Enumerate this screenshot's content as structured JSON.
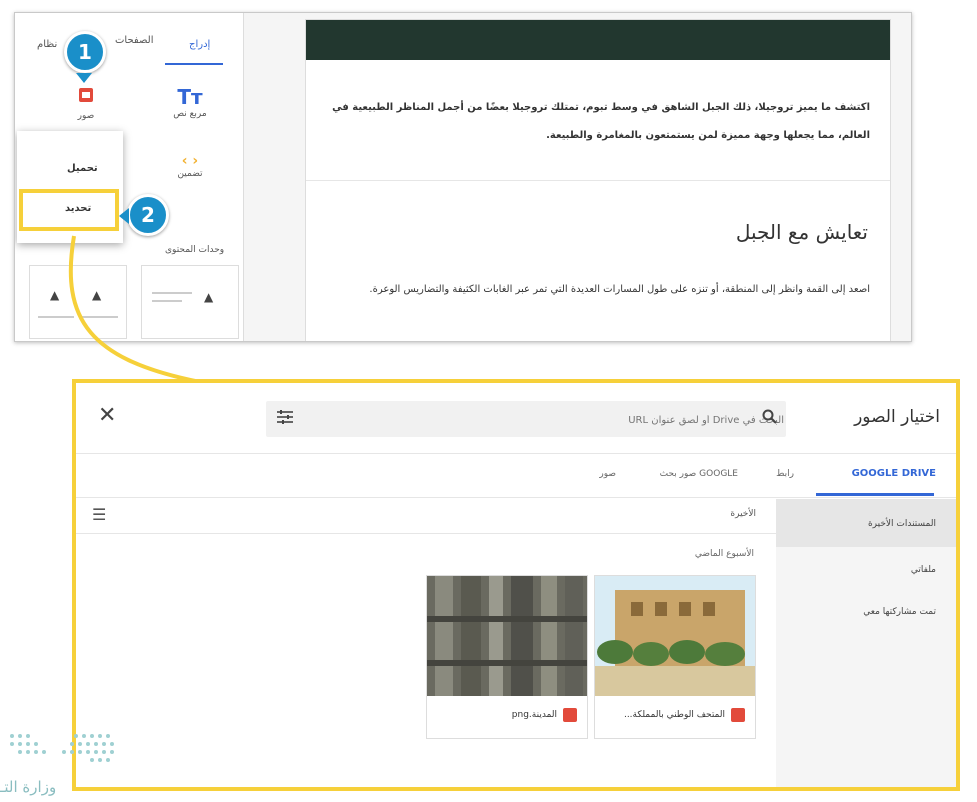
{
  "top_panel": {
    "tabs": [
      "إدراج",
      "الصفحات",
      "نظام"
    ],
    "tools": [
      {
        "label": "مربع نص",
        "icon": "text-box-icon",
        "glyph": "Tт"
      },
      {
        "label": "صور",
        "icon": "image-icon"
      },
      {
        "label": "تضمين",
        "icon": "embed-icon",
        "glyph": "‹ ›"
      }
    ],
    "upload_menu": [
      "تحميل",
      "تحديد"
    ],
    "section_label": "وحدات المحتوى",
    "badges": [
      "1",
      "2"
    ]
  },
  "document": {
    "paragraph1": "اكتشف ما يميز تروجيلا، ذلك الجبل الشاهق في وسط تبوم، تمتلك تروجيلا بعضًا من أجمل المناظر الطبيعية في العالم، مما يجعلها وجهة مميزة لمن يستمتعون بالمغامرة والطبيعة.",
    "heading": "تعايش مع الجبل",
    "paragraph2": "اصعد إلى القمة وانظر إلى المنطقة، أو تنزه على طول المسارات العديدة التي تمر عبر الغابات الكثيفة والتضاريس الوعرة."
  },
  "dialog": {
    "title": "اختيار الصور",
    "search_placeholder": "البحث في Drive أو لصق عنوان URL",
    "close_symbol": "✕",
    "tabs": [
      "GOOGLE DRIVE",
      "رابط",
      "صور بحث GOOGLE",
      "صور"
    ],
    "nav": [
      "المستندات الأخيرة",
      "ملفاتي",
      "تمت مشاركتها معي"
    ],
    "recent_label": "الأخيرة",
    "week_label": "الأسبوع الماضي",
    "photos": [
      {
        "caption": "المتحف الوطني بالمملكة...",
        "icon": "image-file-icon"
      },
      {
        "caption": "المدينة.png",
        "icon": "image-file-icon"
      }
    ]
  },
  "footer": {
    "ministry": "وزارة التـ"
  },
  "colors": {
    "accent": "#3367d6",
    "highlight": "#f6d03a",
    "badge": "#1a8fc9",
    "header": "#22372f"
  }
}
